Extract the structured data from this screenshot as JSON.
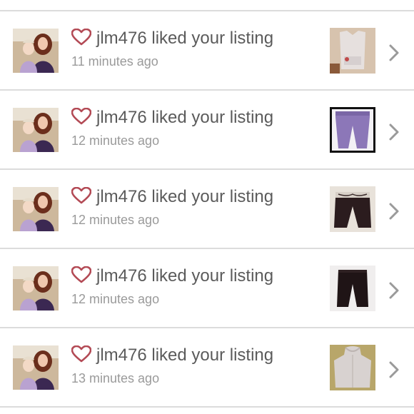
{
  "notifications": [
    {
      "user": "jlm476",
      "action": "liked your listing",
      "time": "11 minutes ago",
      "thumb": "tank-top"
    },
    {
      "user": "jlm476",
      "action": "liked your listing",
      "time": "12 minutes ago",
      "thumb": "purple-pants"
    },
    {
      "user": "jlm476",
      "action": "liked your listing",
      "time": "12 minutes ago",
      "thumb": "black-capris"
    },
    {
      "user": "jlm476",
      "action": "liked your listing",
      "time": "12 minutes ago",
      "thumb": "black-pants"
    },
    {
      "user": "jlm476",
      "action": "liked your listing",
      "time": "13 minutes ago",
      "thumb": "gray-hoodie"
    }
  ],
  "icons": {
    "like": "heart-outline-icon",
    "navigate": "chevron-right-icon"
  },
  "colors": {
    "heart": "#b34a55",
    "title_text": "#5b5b5b",
    "time_text": "#9a9a9a",
    "divider": "#dcdcdc"
  }
}
